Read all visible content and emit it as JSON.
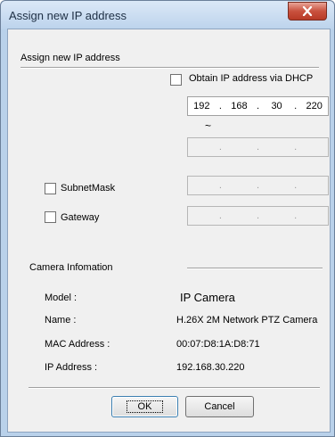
{
  "window": {
    "title": "Assign new IP address"
  },
  "assign": {
    "section_label": "Assign new IP address",
    "dhcp_label": "Obtain IP address via DHCP",
    "dhcp_checked": false,
    "ip_start": [
      "192",
      "168",
      "30",
      "220"
    ],
    "range_separator": "~",
    "ip_end": [
      "",
      "",
      "",
      ""
    ],
    "subnet_label": "SubnetMask",
    "subnet_checked": false,
    "gateway_label": "Gateway",
    "gateway_checked": false,
    "dot": "."
  },
  "camera": {
    "section_label": "Camera Infomation",
    "model_label": "Model :",
    "model_value": "IP Camera",
    "name_label": "Name :",
    "name_value": "H.26X 2M Network PTZ Camera",
    "mac_label": "MAC Address :",
    "mac_value": "00:07:D8:1A:D8:71",
    "ip_label": "IP Address :",
    "ip_value": "192.168.30.220"
  },
  "buttons": {
    "ok": "OK",
    "cancel": "Cancel"
  }
}
